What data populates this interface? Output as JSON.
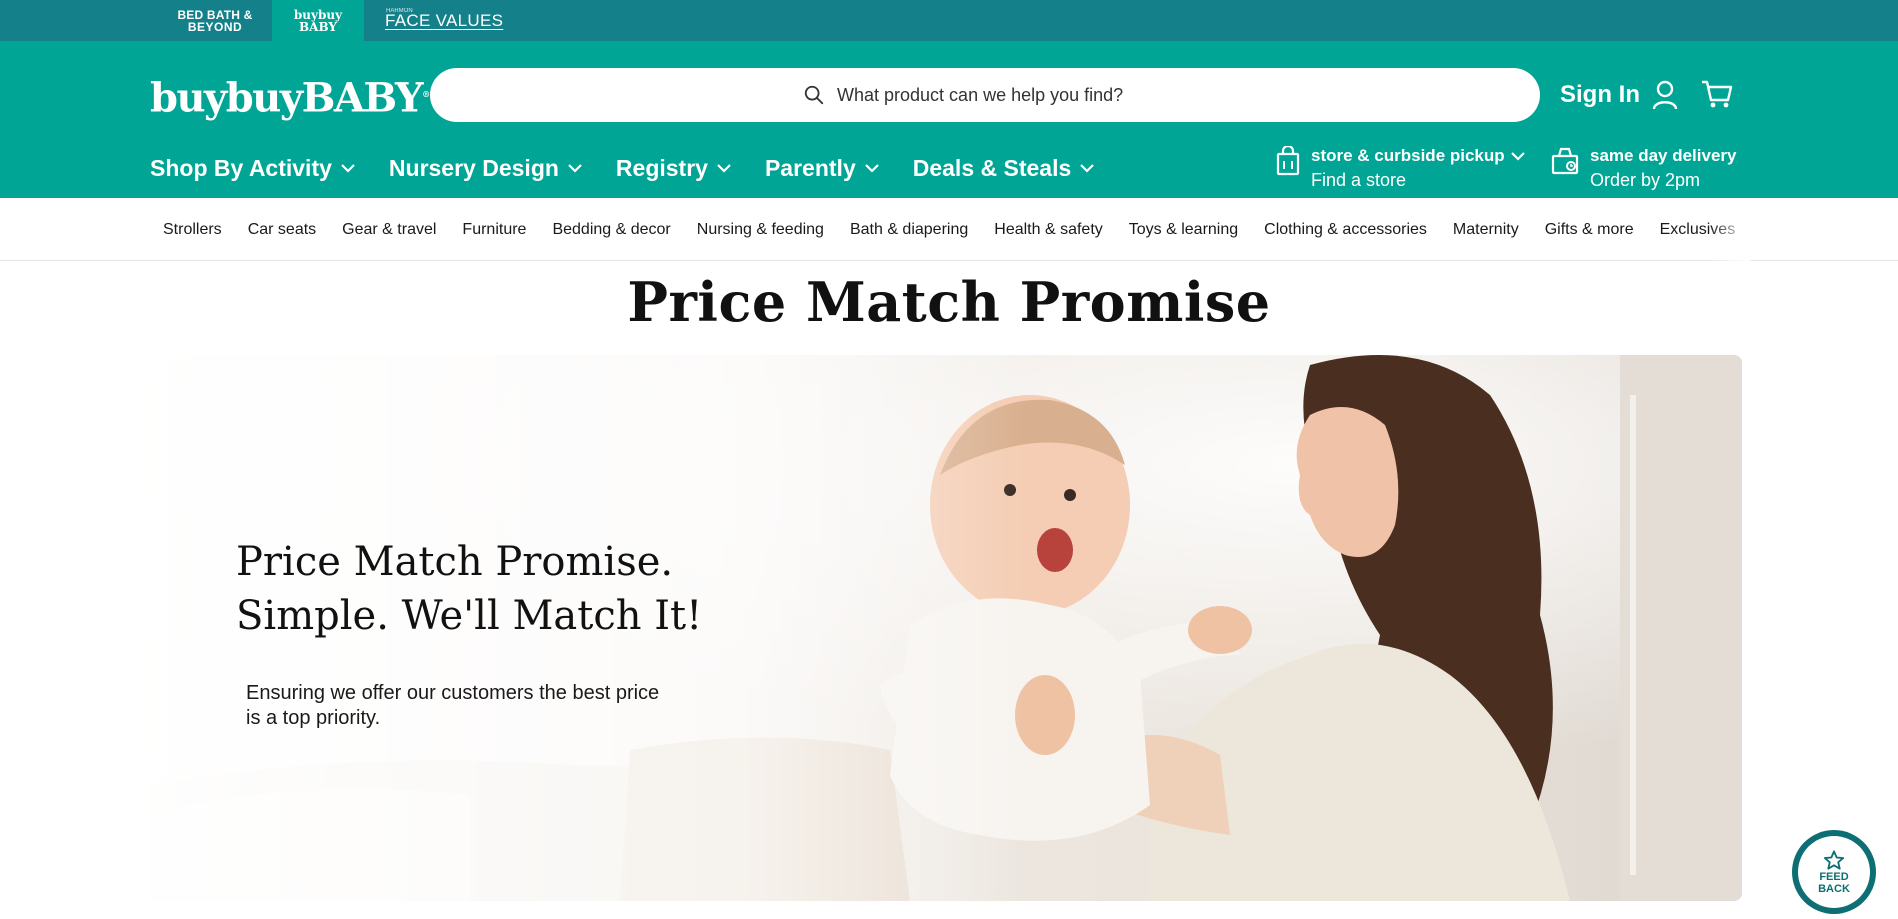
{
  "brand_strip": {
    "bbb_line1": "BED BATH &",
    "bbb_line2": "BEYOND",
    "baby_line1": "buybuy",
    "baby_line2": "BABY",
    "face_small": "HARMON",
    "face_main": "FACE VALUES"
  },
  "header": {
    "logo": "buybuyBABY",
    "search_placeholder": "What product can we help you find?",
    "signin_label": "Sign In",
    "nav": [
      {
        "label": "Shop By Activity"
      },
      {
        "label": "Nursery Design"
      },
      {
        "label": "Registry"
      },
      {
        "label": "Parently"
      },
      {
        "label": "Deals & Steals"
      }
    ],
    "store": {
      "title": "store & curbside pickup",
      "subtitle": "Find a store"
    },
    "delivery": {
      "title": "same day delivery",
      "subtitle": "Order by 2pm"
    }
  },
  "categories": [
    "Strollers",
    "Car seats",
    "Gear & travel",
    "Furniture",
    "Bedding & decor",
    "Nursing & feeding",
    "Bath & diapering",
    "Health & safety",
    "Toys & learning",
    "Clothing & accessories",
    "Maternity",
    "Gifts & more",
    "Exclusives"
  ],
  "page": {
    "title": "Price Match Promise"
  },
  "hero": {
    "heading_line1": "Price Match Promise.",
    "heading_line2": "Simple. We'll Match It!",
    "body": "Ensuring we offer our customers the best price is a top priority."
  },
  "feedback": {
    "line1": "FEED",
    "line2": "BACK"
  },
  "colors": {
    "brand_teal": "#00a595",
    "strip_teal": "#14808a",
    "feedback": "#0d6e74"
  }
}
